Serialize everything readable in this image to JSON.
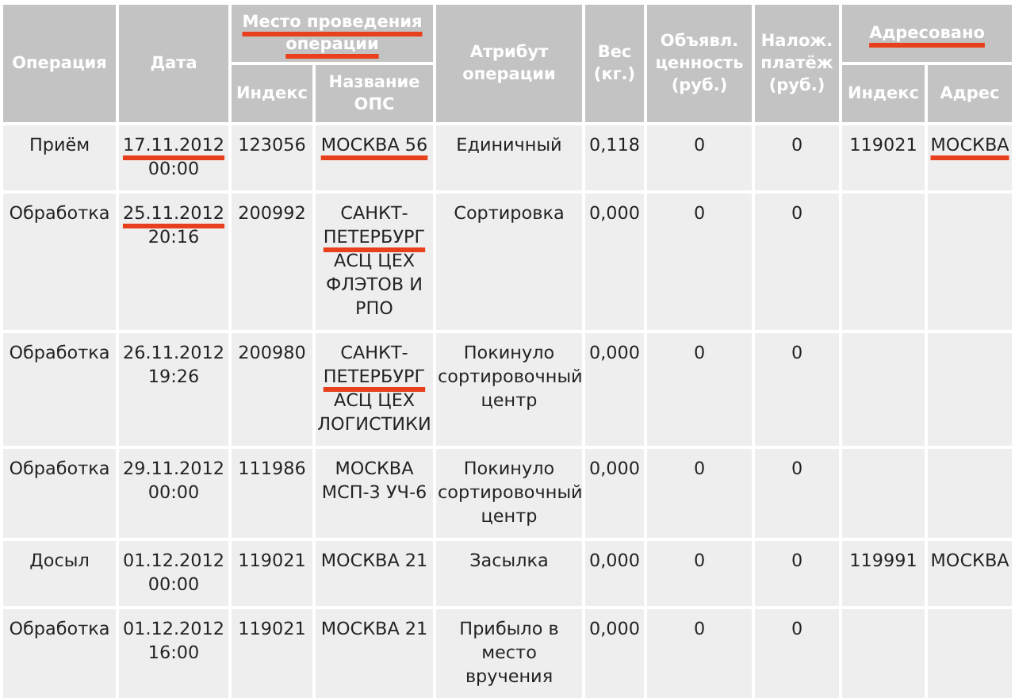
{
  "table": {
    "columns": [
      {
        "label": "Операция",
        "marked": false
      },
      {
        "label": "Дата",
        "marked": false
      },
      {
        "label": "Место проведения операции",
        "marked": true,
        "colspan": 2,
        "children": [
          {
            "label": "Индекс",
            "marked": false
          },
          {
            "label": "Название ОПС",
            "marked": false
          }
        ]
      },
      {
        "label": "Атрибут операции",
        "marked": false
      },
      {
        "label": "Вес (кг.)",
        "marked": false
      },
      {
        "label": "Объявл. ценность (руб.)",
        "marked": false
      },
      {
        "label": "Налож. платёж (руб.)",
        "marked": false
      },
      {
        "label": "Адресовано",
        "marked": true,
        "colspan": 2,
        "children": [
          {
            "label": "Индекс",
            "marked": false
          },
          {
            "label": "Адрес",
            "marked": false
          }
        ]
      }
    ],
    "rows": [
      [
        [
          {
            "text": "Приём",
            "marked": false
          }
        ],
        [
          {
            "text": "17.11.2012",
            "marked": true
          },
          {
            "text": "00:00",
            "marked": false
          }
        ],
        [
          {
            "text": "123056",
            "marked": false
          }
        ],
        [
          {
            "text": "МОСКВА 56",
            "marked": true
          }
        ],
        [
          {
            "text": "Единичный",
            "marked": false
          }
        ],
        [
          {
            "text": "0,118",
            "marked": false
          }
        ],
        [
          {
            "text": "0",
            "marked": false
          }
        ],
        [
          {
            "text": "0",
            "marked": false
          }
        ],
        [
          {
            "text": "119021",
            "marked": false
          }
        ],
        [
          {
            "text": "МОСКВА",
            "marked": true
          }
        ]
      ],
      [
        [
          {
            "text": "Обработка",
            "marked": false
          }
        ],
        [
          {
            "text": "25.11.2012",
            "marked": true
          },
          {
            "text": "20:16",
            "marked": false
          }
        ],
        [
          {
            "text": "200992",
            "marked": false
          }
        ],
        [
          {
            "text": "САНКТ-",
            "marked": false
          },
          {
            "text": "ПЕТЕРБУРГ",
            "marked": true
          },
          {
            "text": "АСЦ ЦЕХ ФЛЭТОВ И РПО",
            "marked": false
          }
        ],
        [
          {
            "text": "Сортировка",
            "marked": false
          }
        ],
        [
          {
            "text": "0,000",
            "marked": false
          }
        ],
        [
          {
            "text": "0",
            "marked": false
          }
        ],
        [
          {
            "text": "0",
            "marked": false
          }
        ],
        [],
        []
      ],
      [
        [
          {
            "text": "Обработка",
            "marked": false
          }
        ],
        [
          {
            "text": "26.11.2012",
            "marked": false
          },
          {
            "text": "19:26",
            "marked": false
          }
        ],
        [
          {
            "text": "200980",
            "marked": false
          }
        ],
        [
          {
            "text": "САНКТ-",
            "marked": false
          },
          {
            "text": "ПЕТЕРБУРГ",
            "marked": true
          },
          {
            "text": "АСЦ ЦЕХ ЛОГИСТИКИ",
            "marked": false
          }
        ],
        [
          {
            "text": "Покинуло сортировочный центр",
            "marked": false
          }
        ],
        [
          {
            "text": "0,000",
            "marked": false
          }
        ],
        [
          {
            "text": "0",
            "marked": false
          }
        ],
        [
          {
            "text": "0",
            "marked": false
          }
        ],
        [],
        []
      ],
      [
        [
          {
            "text": "Обработка",
            "marked": false
          }
        ],
        [
          {
            "text": "29.11.2012",
            "marked": false
          },
          {
            "text": "00:00",
            "marked": false
          }
        ],
        [
          {
            "text": "111986",
            "marked": false
          }
        ],
        [
          {
            "text": "МОСКВА МСП-3 УЧ-6",
            "marked": false
          }
        ],
        [
          {
            "text": "Покинуло сортировочный центр",
            "marked": false
          }
        ],
        [
          {
            "text": "0,000",
            "marked": false
          }
        ],
        [
          {
            "text": "0",
            "marked": false
          }
        ],
        [
          {
            "text": "0",
            "marked": false
          }
        ],
        [],
        []
      ],
      [
        [
          {
            "text": "Досыл",
            "marked": false
          }
        ],
        [
          {
            "text": "01.12.2012",
            "marked": false
          },
          {
            "text": "00:00",
            "marked": false
          }
        ],
        [
          {
            "text": "119021",
            "marked": false
          }
        ],
        [
          {
            "text": "МОСКВА 21",
            "marked": false
          }
        ],
        [
          {
            "text": "Засылка",
            "marked": false
          }
        ],
        [
          {
            "text": "0,000",
            "marked": false
          }
        ],
        [
          {
            "text": "0",
            "marked": false
          }
        ],
        [
          {
            "text": "0",
            "marked": false
          }
        ],
        [
          {
            "text": "119991",
            "marked": false
          }
        ],
        [
          {
            "text": "МОСКВА",
            "marked": false
          }
        ]
      ],
      [
        [
          {
            "text": "Обработка",
            "marked": false
          }
        ],
        [
          {
            "text": "01.12.2012",
            "marked": false
          },
          {
            "text": "16:00",
            "marked": false
          }
        ],
        [
          {
            "text": "119021",
            "marked": false
          }
        ],
        [
          {
            "text": "МОСКВА 21",
            "marked": false
          }
        ],
        [
          {
            "text": "Прибыло в место вручения",
            "marked": false
          }
        ],
        [
          {
            "text": "0,000",
            "marked": false
          }
        ],
        [
          {
            "text": "0",
            "marked": false
          }
        ],
        [
          {
            "text": "0",
            "marked": false
          }
        ],
        [],
        []
      ]
    ]
  }
}
